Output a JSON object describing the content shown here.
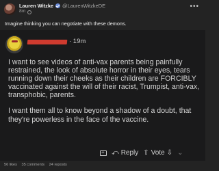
{
  "post": {
    "author_name": "Lauren Witzke",
    "author_handle": "@LaurenWitzkeDE",
    "time": "8m",
    "more": "•••",
    "caption": "Imagine thinking you can negotiate with these demons."
  },
  "embedded": {
    "time": "· 19m",
    "paragraphs": [
      "I want to see videos of anti-vax parents being painfully restrained, the look of absolute horror in their eyes, tears running down their cheeks as their children are FORCIBLY vaccinated against the will of their racist, Trumpist, anti-vax, transphobic, parents.",
      "I want them all to know beyond a shadow of a doubt, that they're powerless in the face of the vaccine."
    ],
    "actions": {
      "reply": "Reply",
      "upvote": "Vote",
      "more": "⌄"
    }
  },
  "footer": {
    "likes": "56 likes",
    "comments": "35 comments",
    "reposts": "24 reposts"
  }
}
